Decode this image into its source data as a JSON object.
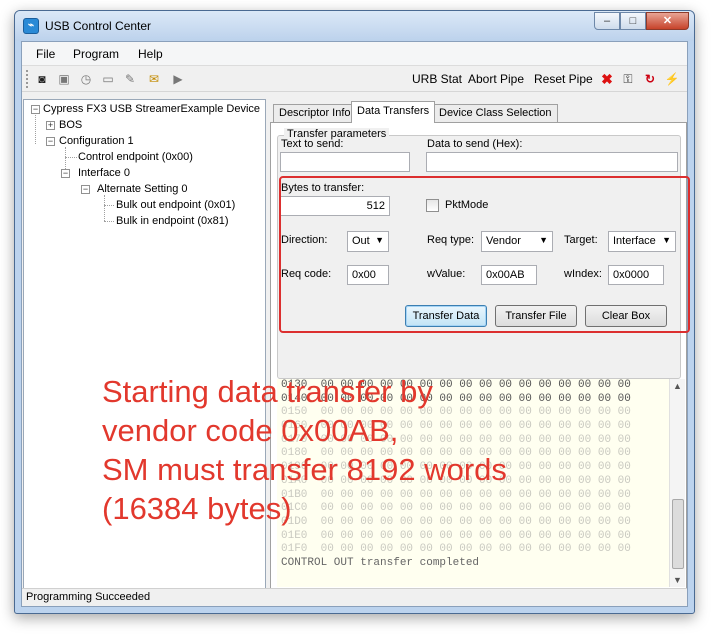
{
  "window": {
    "title": "USB Control Center",
    "minimize": "‒",
    "maximize": "□",
    "close": "✕"
  },
  "menu": [
    "File",
    "Program",
    "Help"
  ],
  "toolbar": {
    "actions": [
      "URB Stat",
      "Abort Pipe",
      "Reset Pipe"
    ],
    "icons": [
      "camera-icon",
      "stop-icon",
      "timer-icon",
      "page-icon",
      "wrench-icon",
      "note-icon",
      "play-icon",
      "x-icon",
      "lock-icon",
      "reset-icon",
      "lightning-icon"
    ]
  },
  "tree": {
    "root": "Cypress FX3 USB StreamerExample Device",
    "bos": "BOS",
    "configuration": "Configuration 1",
    "control_endpoint": "Control endpoint (0x00)",
    "interface": "Interface 0",
    "alternate": "Alternate Setting 0",
    "bulk_out": "Bulk out endpoint (0x01)",
    "bulk_in": "Bulk in endpoint (0x81)"
  },
  "tabs": [
    "Descriptor Info",
    "Data Transfers",
    "Device Class Selection"
  ],
  "active_tab": "Data Transfers",
  "transfer": {
    "group_title": "Transfer parameters",
    "text_to_send_label": "Text to send:",
    "text_to_send": "",
    "hex_to_send_label": "Data to send (Hex):",
    "hex_to_send": "",
    "bytes_label": "Bytes to transfer:",
    "bytes": "512",
    "pktmode_label": "PktMode",
    "direction_label": "Direction:",
    "direction": "Out",
    "reqtype_label": "Req type:",
    "reqtype": "Vendor",
    "target_label": "Target:",
    "target": "Interface",
    "reqcode_label": "Req code:",
    "reqcode": "0x00",
    "wvalue_label": "wValue:",
    "wvalue": "0x00AB",
    "windex_label": "wIndex:",
    "windex": "0x0000",
    "btn_transfer_data": "Transfer Data",
    "btn_transfer_file": "Transfer File",
    "btn_clear": "Clear Box"
  },
  "hex": {
    "rows": [
      "0130  00 00 00 00 00 00 00 00 00 00 00 00 00 00 00 00",
      "0140  00 00 00 00 00 00 00 00 00 00 00 00 00 00 00 00",
      "0150  00 00 00 00 00 00 00 00 00 00 00 00 00 00 00 00",
      "0160  00 00 00 00 00 00 00 00 00 00 00 00 00 00 00 00",
      "0170  00 00 00 00 00 00 00 00 00 00 00 00 00 00 00 00",
      "0180  00 00 00 00 00 00 00 00 00 00 00 00 00 00 00 00",
      "0190  00 00 00 00 00 00 00 00 00 00 00 00 00 00 00 00",
      "01A0  00 00 00 00 00 00 00 00 00 00 00 00 00 00 00 00",
      "01B0  00 00 00 00 00 00 00 00 00 00 00 00 00 00 00 00",
      "01C0  00 00 00 00 00 00 00 00 00 00 00 00 00 00 00 00",
      "01D0  00 00 00 00 00 00 00 00 00 00 00 00 00 00 00 00",
      "01E0  00 00 00 00 00 00 00 00 00 00 00 00 00 00 00 00",
      "01F0  00 00 00 00 00 00 00 00 00 00 00 00 00 00 00 00"
    ],
    "status": "CONTROL OUT transfer completed"
  },
  "statusbar": "Programming Succeeded",
  "annotation": [
    "Starting data transfer by",
    "vendor code 0x00AB,",
    "SM must transfer 8192 words",
    "(16384 bytes)"
  ],
  "colors": {
    "annotation": "#e2382d",
    "highlight_box": "#dc2f2f",
    "hex_background": "#fffff0"
  }
}
